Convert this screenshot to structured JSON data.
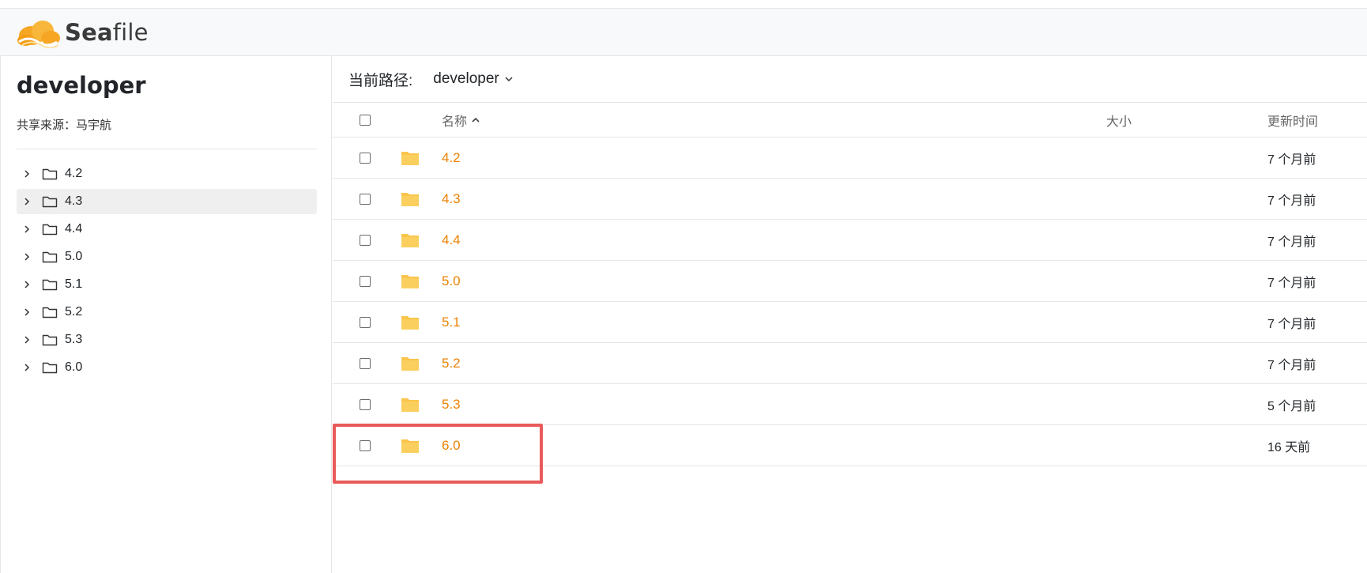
{
  "app": {
    "logo_text_bold": "Sea",
    "logo_text_rest": "file",
    "accent_color": "#eb8205",
    "folder_color": "#f9c54a"
  },
  "sidebar": {
    "repo_name": "developer",
    "shared_from_label": "共享来源：",
    "shared_from_user": "马宇航",
    "tree_items": [
      {
        "label": "4.2",
        "selected": false
      },
      {
        "label": "4.3",
        "selected": true
      },
      {
        "label": "4.4",
        "selected": false
      },
      {
        "label": "5.0",
        "selected": false
      },
      {
        "label": "5.1",
        "selected": false
      },
      {
        "label": "5.2",
        "selected": false
      },
      {
        "label": "5.3",
        "selected": false
      },
      {
        "label": "6.0",
        "selected": false
      }
    ]
  },
  "path_bar": {
    "label": "当前路径:",
    "current": "developer"
  },
  "table": {
    "headers": {
      "name": "名称",
      "size": "大小",
      "updated": "更新时间"
    },
    "rows": [
      {
        "name": "4.2",
        "size": "",
        "updated": "7 个月前"
      },
      {
        "name": "4.3",
        "size": "",
        "updated": "7 个月前"
      },
      {
        "name": "4.4",
        "size": "",
        "updated": "7 个月前"
      },
      {
        "name": "5.0",
        "size": "",
        "updated": "7 个月前"
      },
      {
        "name": "5.1",
        "size": "",
        "updated": "7 个月前"
      },
      {
        "name": "5.2",
        "size": "",
        "updated": "7 个月前"
      },
      {
        "name": "5.3",
        "size": "",
        "updated": "5 个月前"
      },
      {
        "name": "6.0",
        "size": "",
        "updated": "16 天前"
      }
    ]
  },
  "annotation": {
    "highlight_color": "#ea5a5a",
    "highlighted_row": "6.0"
  }
}
